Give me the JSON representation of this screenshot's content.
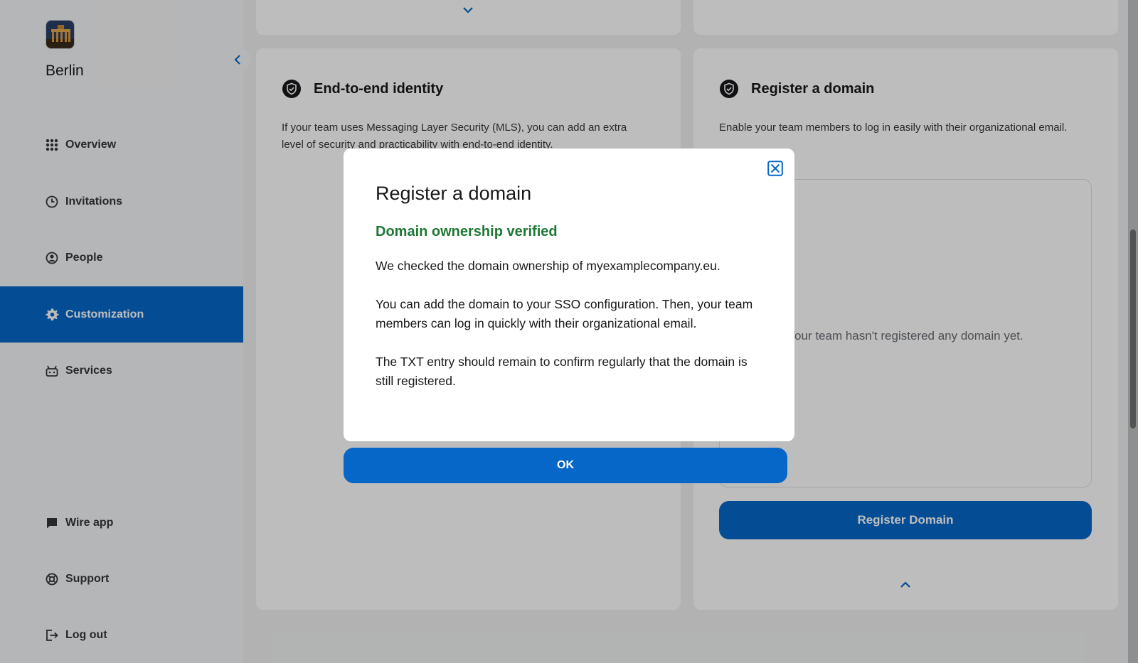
{
  "team": {
    "name": "Berlin",
    "logo_icon": "brandenburg-gate-image"
  },
  "sidebar": {
    "collapse_icon": "chevron-left-icon",
    "items": [
      {
        "label": "Overview",
        "icon": "grid-icon",
        "active": false
      },
      {
        "label": "Invitations",
        "icon": "clock-icon",
        "active": false
      },
      {
        "label": "People",
        "icon": "user-circle-icon",
        "active": false
      },
      {
        "label": "Customization",
        "icon": "gear-icon",
        "active": true
      },
      {
        "label": "Services",
        "icon": "services-icon",
        "active": false
      }
    ],
    "bottom_items": [
      {
        "label": "Wire app",
        "icon": "chat-bubble-icon"
      },
      {
        "label": "Support",
        "icon": "lifebuoy-icon"
      },
      {
        "label": "Log out",
        "icon": "logout-icon"
      }
    ]
  },
  "cards": {
    "e2e": {
      "title": "End-to-end identity",
      "description": "If your team uses Messaging Layer Security (MLS), you can add an extra level of security and practicability with end-to-end identity."
    },
    "domain": {
      "title": "Register a domain",
      "description": "Enable your team members to log in easily with their organizational email.",
      "empty_text": "Your team hasn't registered any domain yet.",
      "button_label": "Register Domain"
    }
  },
  "modal": {
    "title": "Register a domain",
    "subtitle": "Domain ownership verified",
    "paragraphs": [
      "We checked the domain ownership of myexamplecompany.eu.",
      "You can add the domain to your SSO configuration. Then, your team members can log in quickly with their organizational email.",
      "The TXT entry should remain to confirm regularly that the domain is still registered."
    ],
    "ok_label": "OK",
    "close_icon": "close-icon"
  },
  "colors": {
    "accent": "#0667c8",
    "success": "#1d7833",
    "background": "#f0f1f2"
  }
}
